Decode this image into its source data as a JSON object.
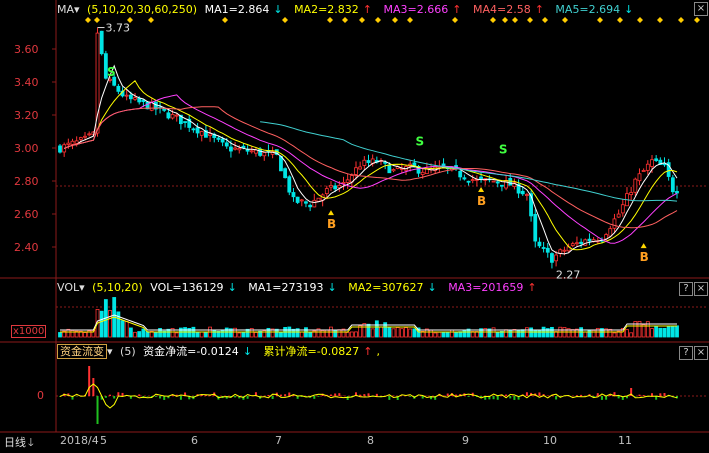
{
  "price_header": {
    "indicator": "MA",
    "params": "(5,10,20,30,60,250)",
    "ma1": "MA1=2.864",
    "ma2": "MA2=2.832",
    "ma3": "MA3=2.666",
    "ma4": "MA4=2.58",
    "ma5": "MA5=2.694",
    "arrow_up": "↑",
    "arrow_down": "↓"
  },
  "price_axis": [
    "3.60",
    "3.40",
    "3.20",
    "3.00",
    "2.80",
    "2.60",
    "2.40"
  ],
  "price_annotations": {
    "high": "3.73",
    "low": "2.27",
    "buy": "B",
    "sell": "S"
  },
  "vol_header": {
    "indicator": "VOL",
    "params": "(5,10,20)",
    "vol": "VOL=136129",
    "ma1": "MA1=273193",
    "ma2": "MA2=307627",
    "ma3": "MA3=201659"
  },
  "vol_axis": {
    "unit": "x1000"
  },
  "fund_header": {
    "indicator": "资金流变",
    "params": "(5)",
    "net": "资金净流=-0.0124",
    "cum": "累计净流=-0.0827",
    "tail": ","
  },
  "fund_axis": {
    "zero": "0"
  },
  "xaxis": {
    "period": "日线",
    "labels": [
      "2018/4",
      "5",
      "6",
      "7",
      "8",
      "9",
      "10",
      "11"
    ]
  },
  "colors": {
    "up": "#ff3232",
    "down": "#00e5e5",
    "ma1": "#ffffff",
    "ma2": "#ffff00",
    "ma3": "#ff40ff",
    "ma4": "#ff6060",
    "ma5": "#40d0d0",
    "grid": "#8b1a1a",
    "axis_text": "#e0383e",
    "marker": "#ffd700"
  }
}
